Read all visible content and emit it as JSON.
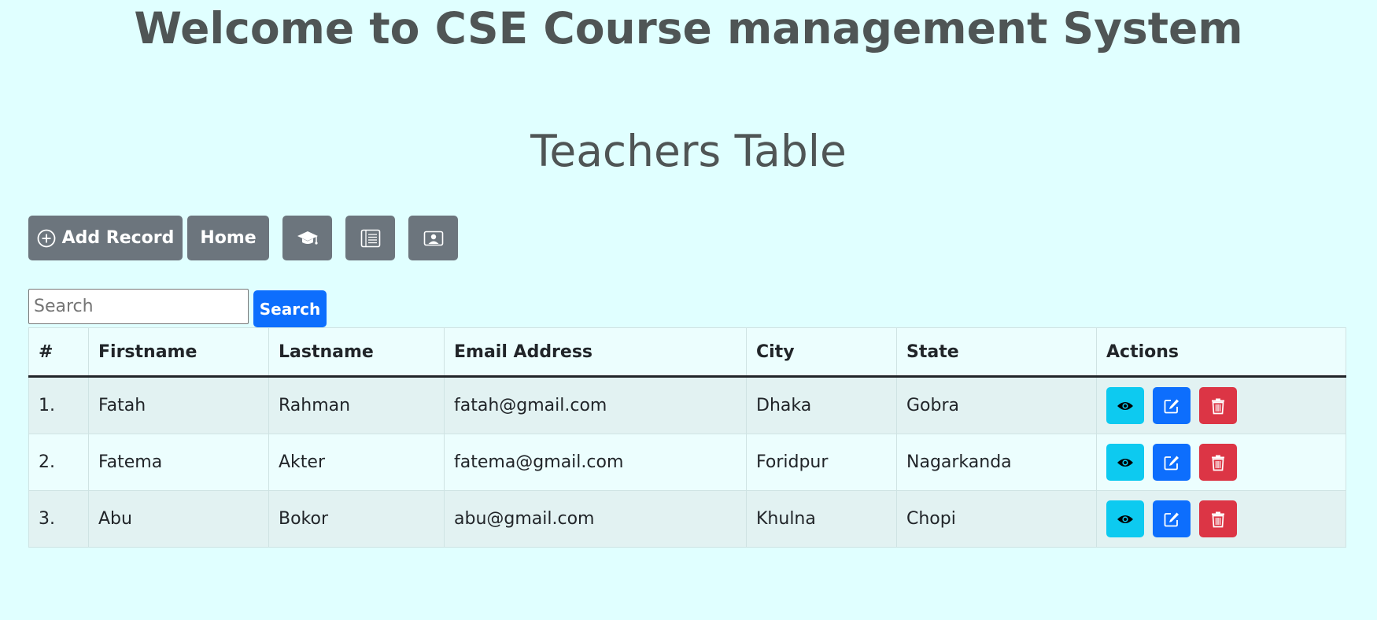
{
  "header": {
    "title": "Welcome to CSE Course management System",
    "subtitle": "Teachers Table"
  },
  "toolbar": {
    "add_record_label": "Add Record",
    "home_label": "Home",
    "add_icon": "plus-circle-icon",
    "courses_icon": "graduation-cap-icon",
    "list_icon": "list-icon",
    "profile_icon": "person-card-icon"
  },
  "search": {
    "placeholder": "Search",
    "value": "",
    "button_label": "Search"
  },
  "table": {
    "columns": [
      "#",
      "Firstname",
      "Lastname",
      "Email Address",
      "City",
      "State",
      "Actions"
    ],
    "rows": [
      {
        "num": "1.",
        "firstname": "Fatah",
        "lastname": "Rahman",
        "email": "fatah@gmail.com",
        "city": "Dhaka",
        "state": "Gobra"
      },
      {
        "num": "2.",
        "firstname": "Fatema",
        "lastname": "Akter",
        "email": "fatema@gmail.com",
        "city": "Foridpur",
        "state": "Nagarkanda"
      },
      {
        "num": "3.",
        "firstname": "Abu",
        "lastname": "Bokor",
        "email": "abu@gmail.com",
        "city": "Khulna",
        "state": "Chopi"
      }
    ],
    "action_icons": [
      "eye-icon",
      "edit-icon",
      "trash-icon"
    ]
  },
  "colors": {
    "background": "#e0ffff",
    "heading": "#4f5555",
    "secondary": "#6c757d",
    "primary": "#0d6efd",
    "info": "#0dcaf0",
    "danger": "#dc3545"
  }
}
